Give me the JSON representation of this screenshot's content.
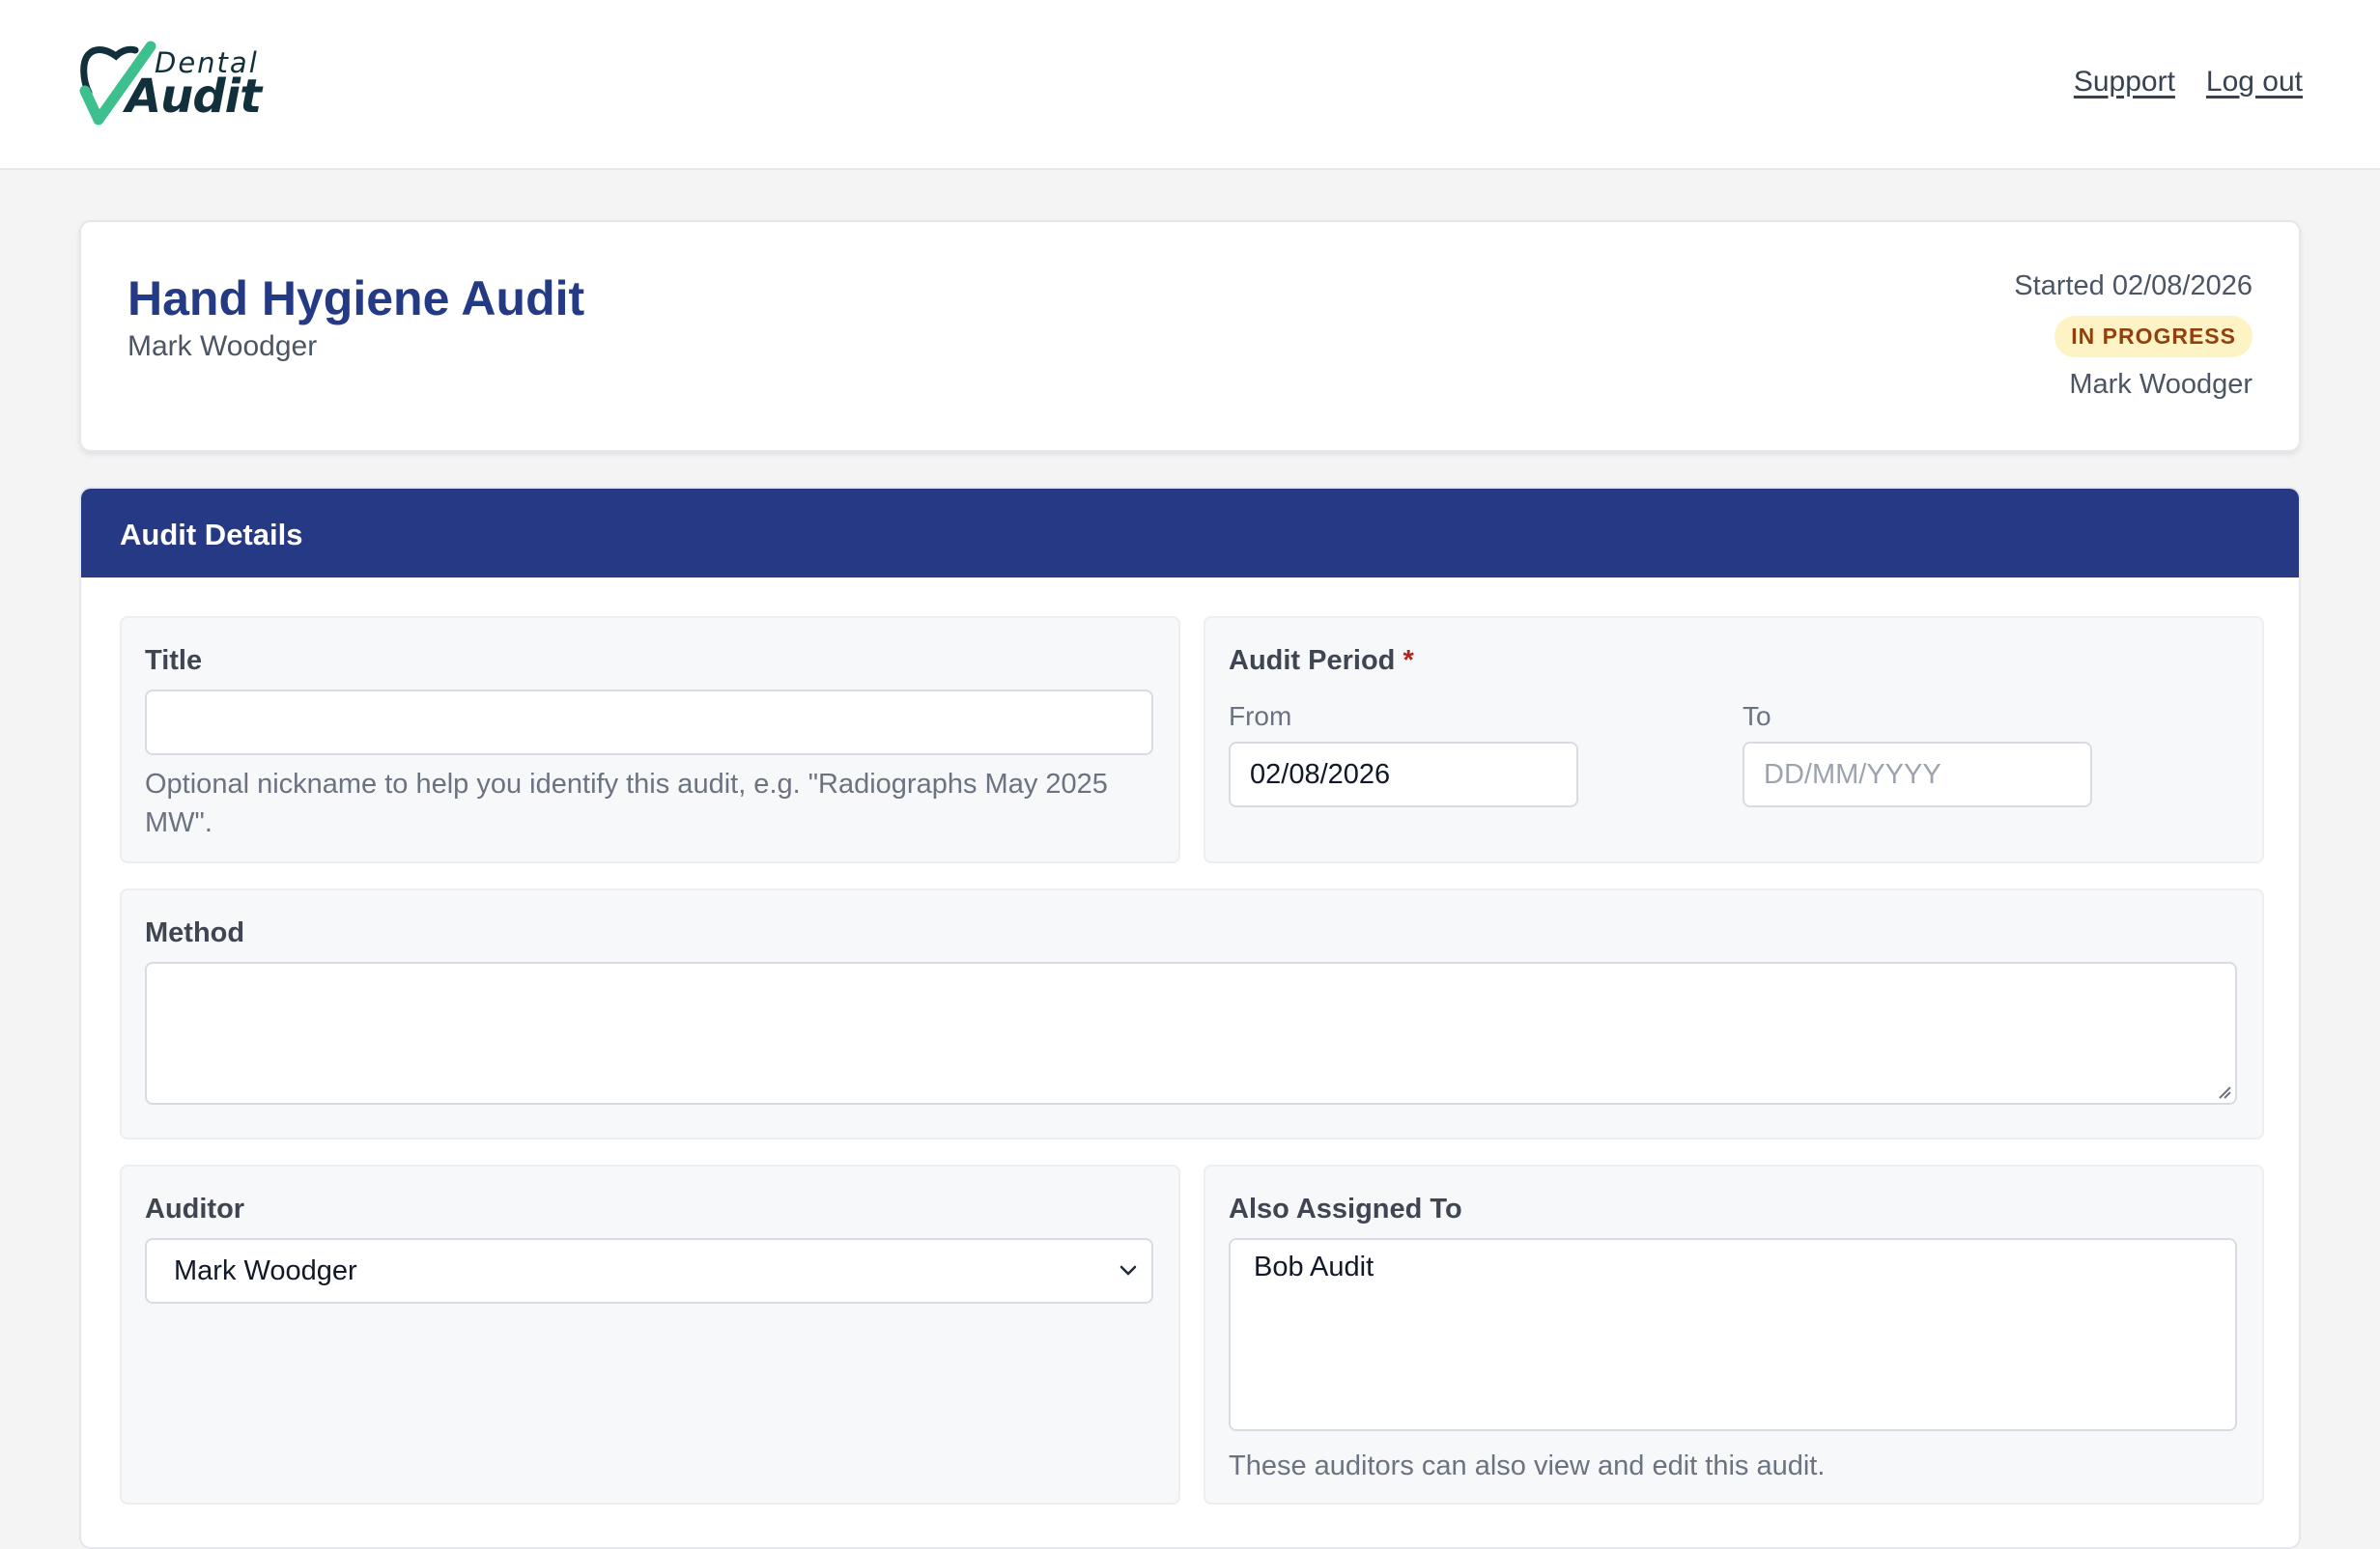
{
  "logo": {
    "small": "Dental",
    "big": "Audit"
  },
  "nav": {
    "support": "Support",
    "logout": "Log out"
  },
  "audit": {
    "title": "Hand Hygiene Audit",
    "owner": "Mark Woodger",
    "started": "Started 02/08/2026",
    "status": "IN PROGRESS",
    "assigned_user": "Mark Woodger"
  },
  "section": {
    "title": "Audit Details"
  },
  "form": {
    "title_label": "Title",
    "title_value": "",
    "title_help": "Optional nickname to help you identify this audit, e.g. \"Radiographs May 2025 MW\".",
    "period_label": "Audit Period",
    "period_required_mark": "*",
    "from_label": "From",
    "from_value": "02/08/2026",
    "to_label": "To",
    "to_placeholder": "DD/MM/YYYY",
    "method_label": "Method",
    "method_value": "",
    "auditor_label": "Auditor",
    "auditor_selected": "Mark Woodger",
    "also_label": "Also Assigned To",
    "also_value": "Bob Audit",
    "also_help": "These auditors can also view and edit this audit."
  },
  "colors": {
    "accent": "#263984",
    "title": "#243a85",
    "badge_bg": "#fdf3c4",
    "badge_text": "#92400e",
    "logo_check": "#3dbf8e"
  },
  "icons": {
    "logo": "tooth-check-icon",
    "select": "chevron-down-icon",
    "resize": "resize-grip-icon"
  }
}
